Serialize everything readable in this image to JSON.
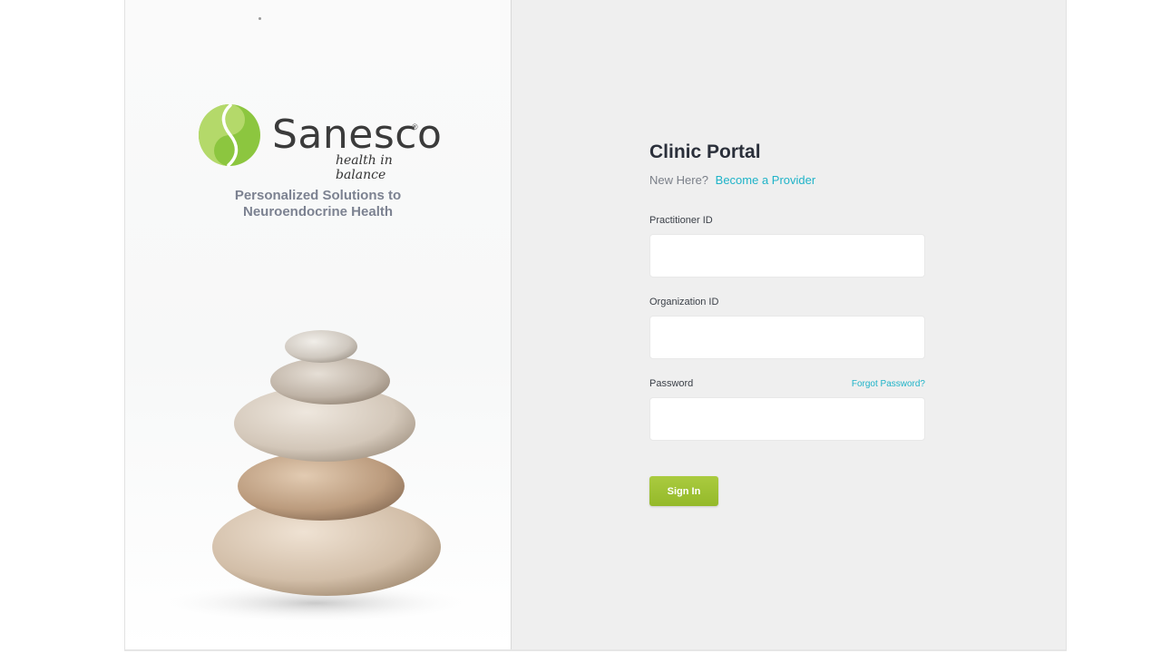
{
  "brand": {
    "name": "Sanesco",
    "registered": "®",
    "tagline_italic": "health in balance",
    "tagline_lines": [
      "Personalized Solutions to",
      "Neuroendocrine Health"
    ],
    "logo_color": "#8cc63f"
  },
  "portal": {
    "title": "Clinic Portal",
    "new_here": "New Here?",
    "become_provider": "Become a Provider"
  },
  "fields": {
    "practitioner_label": "Practitioner ID",
    "practitioner_value": "",
    "organization_label": "Organization ID",
    "organization_value": "",
    "password_label": "Password",
    "password_value": "",
    "forgot_password": "Forgot Password?"
  },
  "actions": {
    "sign_in": "Sign In"
  },
  "colors": {
    "accent_link": "#1fb3c8",
    "button_green": "#9cc135",
    "panel_background": "#efefef"
  }
}
